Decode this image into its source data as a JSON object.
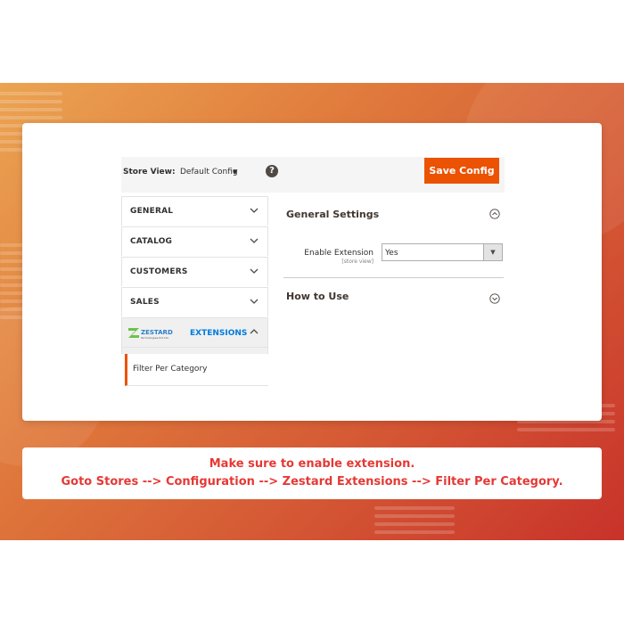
{
  "toolbar": {
    "store_view_label": "Store View:",
    "store_view_value": "Default Config",
    "help_icon": "?",
    "save_label": "Save Config"
  },
  "sidebar": {
    "items": [
      {
        "label": "GENERAL",
        "icon": "chevron-down-icon"
      },
      {
        "label": "CATALOG",
        "icon": "chevron-down-icon"
      },
      {
        "label": "CUSTOMERS",
        "icon": "chevron-down-icon"
      },
      {
        "label": "SALES",
        "icon": "chevron-down-icon"
      }
    ],
    "extensions": {
      "logo_text": "ZESTARD",
      "logo_subtext": "Technologies Pvt Ltd",
      "label": "EXTENSIONS",
      "icon": "chevron-up-icon"
    },
    "subitem": "Filter Per Category"
  },
  "main": {
    "general_settings_title": "General Settings",
    "enable_extension_label": "Enable Extension",
    "enable_extension_scope": "[store view]",
    "enable_extension_value": "Yes",
    "how_to_use_title": "How to Use"
  },
  "note": {
    "line1": "Make sure to enable extension.",
    "line2": "Goto Stores --> Configuration --> Zestard Extensions --> Filter Per Category."
  },
  "colors": {
    "accent": "#eb5202",
    "note_text": "#e53935",
    "extension_link": "#007bdb"
  }
}
